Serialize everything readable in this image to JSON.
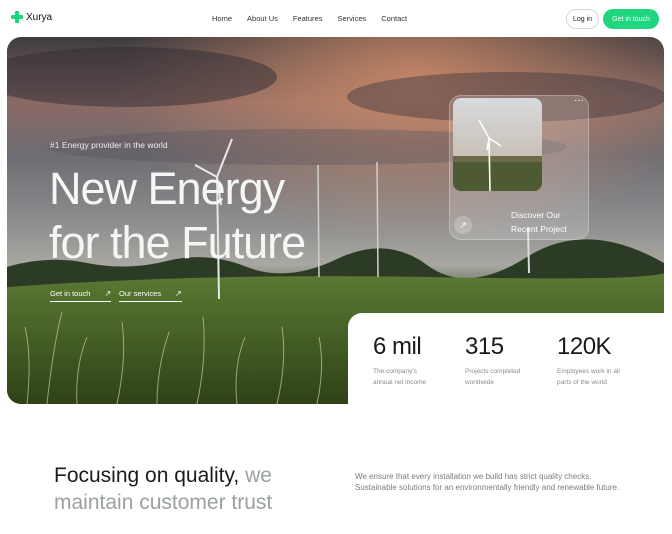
{
  "brand": {
    "name": "Xurya",
    "accent": "#1fd67f"
  },
  "nav": {
    "items": [
      "Home",
      "About Us",
      "Features",
      "Services",
      "Contact"
    ],
    "login_label": "Log in",
    "cta_label": "Get in touch"
  },
  "hero": {
    "tagline": "#1 Energy provider in the world",
    "headline_line1": "New Energy",
    "headline_line2": "for the Future",
    "links": [
      {
        "label": "Get in touch",
        "icon": "arrow-up-right-icon",
        "arrow": "↗"
      },
      {
        "label": "Our services",
        "icon": "arrow-up-right-icon",
        "arrow": "↗"
      }
    ]
  },
  "project_card": {
    "title": "Discover Our Recent Project",
    "menu_icon": "more-horizontal-icon",
    "menu_glyph": "···",
    "arrow_icon": "arrow-up-right-icon",
    "arrow_glyph": "↗"
  },
  "stats": [
    {
      "value": "6 mil",
      "desc_line1": "The company's",
      "desc_line2": "annual net income"
    },
    {
      "value": "315",
      "desc_line1": "Projects completed",
      "desc_line2": "worldwide"
    },
    {
      "value": "120K",
      "desc_line1": "Employees work in all",
      "desc_line2": "parts of the world"
    }
  ],
  "quality": {
    "heading_dark": "Focusing on quality,",
    "heading_muted_1": "we",
    "heading_muted_2": "maintain customer trust",
    "text": "We ensure that every installation we build has strict quality checks. Sustainable solutions for an environmentally friendly and renewable future."
  }
}
